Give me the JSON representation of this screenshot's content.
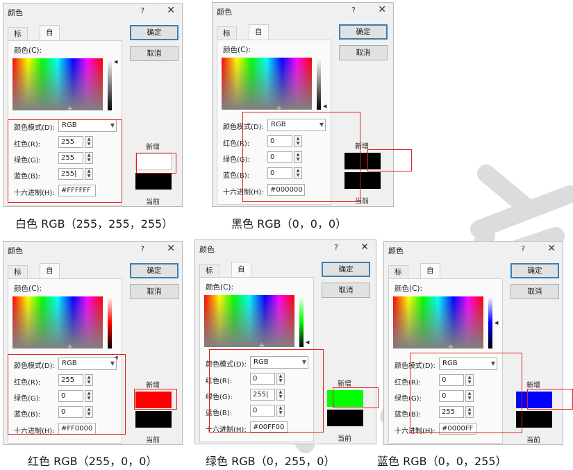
{
  "dialog": {
    "title": "颜色",
    "help": "?",
    "close": "✕",
    "tab_standard": "标准",
    "tab_custom": "自定义",
    "colors_label": "颜色(C):",
    "mode_label": "颜色模式(D):",
    "mode_value": "RGB",
    "red_label": "红色(R):",
    "green_label": "绿色(G):",
    "blue_label": "蓝色(B):",
    "hex_label": "十六进制(H):",
    "ok": "确定",
    "cancel": "取消",
    "new_label": "新增",
    "current_label": "当前"
  },
  "panels": [
    {
      "red": "255",
      "green": "255",
      "blue": "255|",
      "hex": "#FFFFFF",
      "new_color": "#ffffff",
      "slider_top": "#ffffff",
      "caption": "白色 RGB（255，255，255）"
    },
    {
      "red": "0",
      "green": "0",
      "blue": "0",
      "hex": "#000000",
      "new_color": "#000000",
      "slider_top": "#ffffff",
      "caption": "黑色 RGB（0，0，0）"
    },
    {
      "red": "255",
      "green": "0",
      "blue": "0",
      "hex": "#FF0000",
      "new_color": "#ff0000",
      "slider_top": "#ffffff",
      "caption": "红色 RGB（255，0，0）"
    },
    {
      "red": "0",
      "green": "255|",
      "blue": "0",
      "hex": "#00FF00",
      "new_color": "#00ff00",
      "slider_top": "#ffffff",
      "caption": "绿色 RGB（0，255，0）"
    },
    {
      "red": "0",
      "green": "0",
      "blue": "255",
      "hex": "#0000FF",
      "new_color": "#0000ff",
      "slider_top": "#ffffff",
      "caption": "蓝色 RGB（0，0，255）"
    }
  ],
  "colors": {
    "highlight": "#e0201a",
    "current_color": "#000000"
  }
}
